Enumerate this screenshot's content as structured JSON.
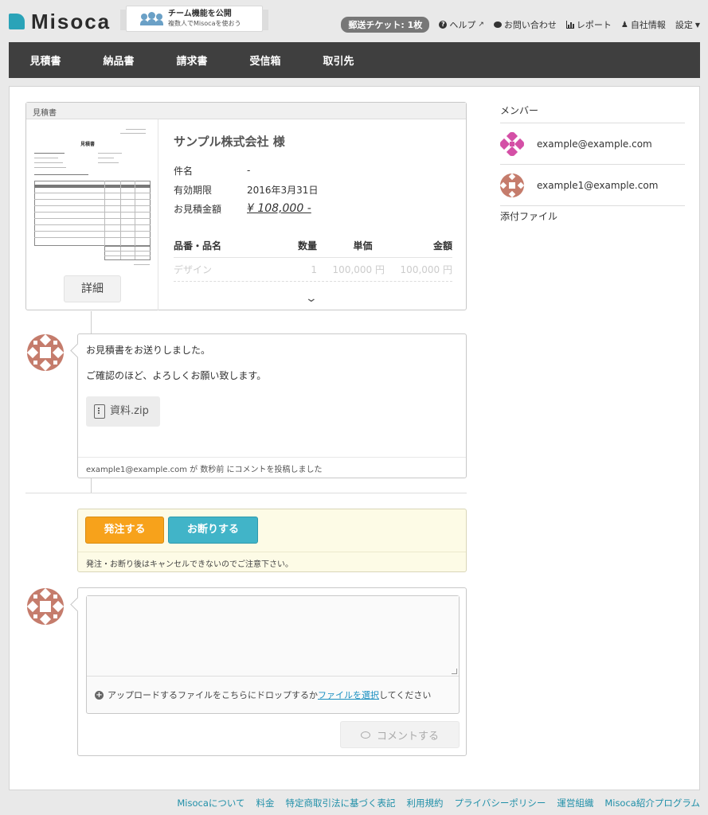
{
  "header": {
    "logo_text": "Misoca",
    "banner_title": "チーム機能を公開",
    "banner_sub": "複数人でMisocaを使おう",
    "ticket": "郵送チケット: 1枚",
    "help": "ヘルプ",
    "contact": "お問い合わせ",
    "report": "レポート",
    "company_info": "自社情報",
    "settings": "設定"
  },
  "nav": {
    "items": [
      "見積書",
      "納品書",
      "請求書",
      "受信箱",
      "取引先"
    ]
  },
  "document": {
    "card_label": "見積書",
    "thumb_title": "見積書",
    "detail_button": "詳細",
    "company": "サンプル株式会社 様",
    "subject_label": "件名",
    "subject_value": "-",
    "expiry_label": "有効期限",
    "expiry_value": "2016年3月31日",
    "amount_label": "お見積金額",
    "amount_value": "¥ 108,000 -",
    "columns": [
      "品番・品名",
      "数量",
      "単価",
      "金額"
    ],
    "rows": [
      {
        "name": "デザイン",
        "qty": "1",
        "price": "100,000 円",
        "total": "100,000 円"
      }
    ]
  },
  "comment": {
    "line1": "お見積書をお送りしました。",
    "line2": "ご確認のほど、よろしくお願い致します。",
    "attachment": "資料.zip",
    "footer": "example1@example.com が 数秒前 にコメントを投稿しました"
  },
  "actions": {
    "order": "発注する",
    "decline": "お断りする",
    "note": "発注・お断り後はキャンセルできないのでご注意下さい。"
  },
  "compose": {
    "drop_prefix": "アップロードするファイルをこちらにドロップするか",
    "drop_link": "ファイルを選択",
    "drop_suffix": "してください",
    "submit": "コメントする"
  },
  "sidebar": {
    "members_title": "メンバー",
    "members": [
      {
        "email": "example@example.com",
        "color": "#d44fa6"
      },
      {
        "email": "example1@example.com",
        "color": "#c57c6c"
      }
    ],
    "attachments_title": "添付ファイル"
  },
  "footer": {
    "links": [
      "Misocaについて",
      "料金",
      "特定商取引法に基づく表記",
      "利用規約",
      "プライバシーポリシー",
      "運営組織",
      "Misoca紹介プログラム"
    ]
  },
  "colors": {
    "accent": "#2aa3b8",
    "order": "#f7a21b",
    "decline": "#41b4c8",
    "nav_bg": "#3f3f3f",
    "link": "#1f8fa8"
  }
}
